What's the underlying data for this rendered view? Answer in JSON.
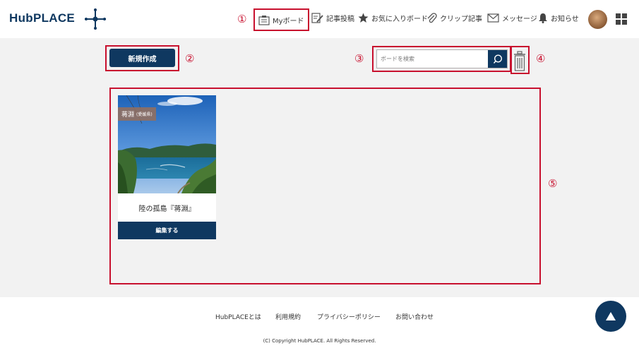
{
  "header": {
    "logo_text": "HubPLACE",
    "nav": [
      {
        "label": "Myボード",
        "icon": "board-icon"
      },
      {
        "label": "記事投稿",
        "icon": "edit-icon"
      },
      {
        "label": "お気に入りボード",
        "icon": "star-icon"
      },
      {
        "label": "クリップ記事",
        "icon": "paperclip-icon"
      },
      {
        "label": "メッセージ",
        "icon": "envelope-icon"
      },
      {
        "label": "お知らせ",
        "icon": "bell-icon"
      }
    ]
  },
  "annotations": {
    "n1": "①",
    "n2": "②",
    "n3": "③",
    "n4": "④",
    "n5": "⑤"
  },
  "toolbar": {
    "new_label": "新規作成",
    "search_placeholder": "ボードを検索"
  },
  "board": {
    "tag_main": "蒋淵",
    "tag_sub": "(愛媛県)",
    "title": "陸の孤島『蒋淵』",
    "edit_label": "編集する"
  },
  "footer": {
    "links": [
      "HubPLACEとは",
      "利用規約",
      "プライバシーポリシー",
      "お問い合わせ"
    ],
    "copyright": "(C) Copyright HubPLACE. All Rights Reserved."
  },
  "colors": {
    "navy": "#0f3860",
    "annotation_red": "#c8102e",
    "background": "#f2f2f2"
  }
}
